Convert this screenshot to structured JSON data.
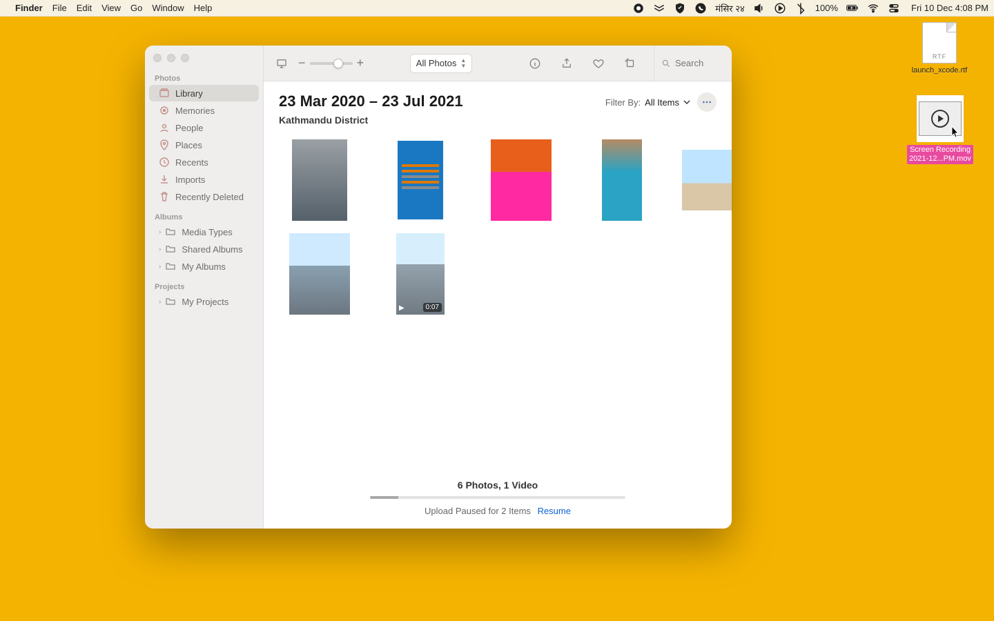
{
  "menubar": {
    "app": "Finder",
    "items": [
      "File",
      "Edit",
      "View",
      "Go",
      "Window",
      "Help"
    ],
    "right": {
      "nepali_date": "मंसिर २४",
      "battery_pct": "100%",
      "clock": "Fri 10 Dec  4:08 PM"
    }
  },
  "desktop": {
    "rtf_filename": "launch_xcode.rtf",
    "rtf_badge": "RTF",
    "video_filename_line1": "Screen Recording",
    "video_filename_line2": "2021-12...PM.mov"
  },
  "photos_window": {
    "toolbar": {
      "view_selector": "All Photos",
      "zoom_minus": "−",
      "zoom_plus": "+",
      "search_placeholder": "Search"
    },
    "title": "23 Mar 2020 – 23 Jul 2021",
    "subtitle": "Kathmandu District",
    "filter_prefix": "Filter By:",
    "filter_value": "All Items",
    "sidebar": {
      "section_photos": "Photos",
      "items_photos": [
        "Library",
        "Memories",
        "People",
        "Places",
        "Recents",
        "Imports",
        "Recently Deleted"
      ],
      "section_albums": "Albums",
      "items_albums": [
        "Media Types",
        "Shared Albums",
        "My Albums"
      ],
      "section_projects": "Projects",
      "items_projects": [
        "My Projects"
      ]
    },
    "grid": {
      "video_duration": "0:07"
    },
    "footer": {
      "summary": "6 Photos, 1 Video",
      "upload_status": "Upload Paused for 2 Items",
      "resume": "Resume"
    }
  }
}
